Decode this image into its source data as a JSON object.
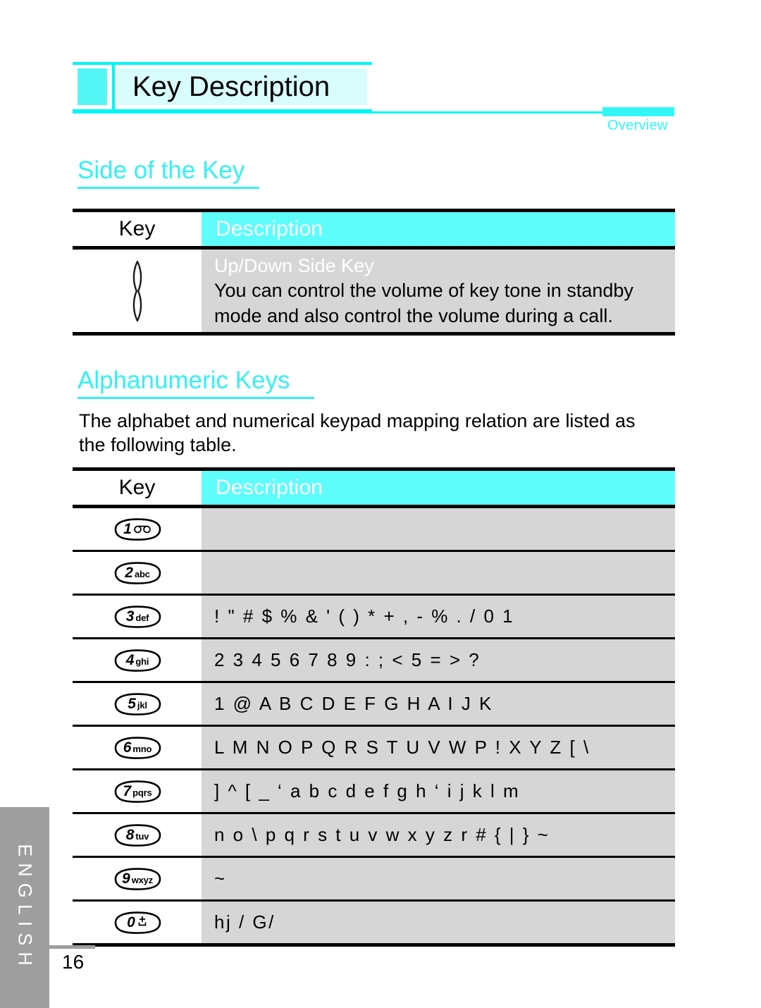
{
  "document": {
    "header_title": "Key Description",
    "chapter_tab": "Overview",
    "language_tab": "ENGLISH",
    "page_number": "16"
  },
  "sections": [
    {
      "id": "side-of-the-key",
      "heading": "Side of the Key"
    },
    {
      "id": "alphanumeric-keys",
      "heading": "Alphanumeric Keys",
      "intro": "The alphabet and numerical keypad mapping relation are listed as the following table."
    }
  ],
  "table_side": {
    "columns": {
      "key": "Key",
      "description": "Description"
    },
    "rows": [
      {
        "key_icon": "side-key-icon",
        "subtitle": "Up/Down Side Key",
        "text_line1": "You can control the volume of key tone in standby",
        "text_line2": "mode and also control the volume during a call."
      }
    ]
  },
  "table_alpha": {
    "columns": {
      "key": "Key",
      "description": "Description"
    },
    "rows": [
      {
        "num": "1",
        "sub": "",
        "icon": "voicemail-icon",
        "desc": ""
      },
      {
        "num": "2",
        "sub": "abc",
        "icon": "",
        "desc": ""
      },
      {
        "num": "3",
        "sub": "def",
        "icon": "",
        "desc": "! \" # $ % & ' ( ) * + , - %  . / 0 1"
      },
      {
        "num": "4",
        "sub": "ghi",
        "icon": "",
        "desc": "2 3  4 5 6 7 8 9 : ; < 5 = > ?"
      },
      {
        "num": "5",
        "sub": "jkl",
        "icon": "",
        "desc": " 1 @ A B C D E F G H A I J K"
      },
      {
        "num": "6",
        "sub": "mno",
        "icon": "",
        "desc": "L M N O P Q R S T U V W P  ! X Y Z [ \\"
      },
      {
        "num": "7",
        "sub": "pqrs",
        "icon": "",
        "desc": "] ^ [ _ ‘ a b c d e f g h ‘ i j k l m"
      },
      {
        "num": "8",
        "sub": "tuv",
        "icon": "",
        "desc": "n o \\ p q r s t u v w x y z r # { | } ~"
      },
      {
        "num": "9",
        "sub": "wxyz",
        "icon": "",
        "desc": " ~"
      },
      {
        "num": "0",
        "sub": "",
        "icon": "plus-underline-icon",
        "desc": " hj  / G/"
      }
    ]
  },
  "colors": {
    "accent_cyan": "#33f2f2",
    "header_cyan": "#5ffcfc",
    "header_pale": "#d9fdfd",
    "row_gray": "#d6d6d6",
    "tab_gray": "#9e9e9e"
  }
}
